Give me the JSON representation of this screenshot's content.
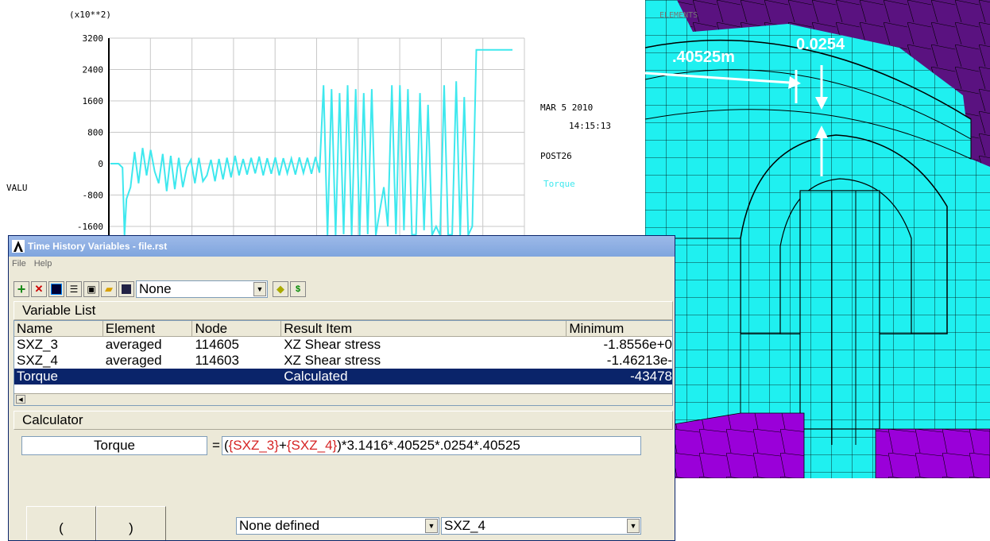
{
  "plot": {
    "exponent_label": "(x10**2)",
    "y_ticks": [
      "3200",
      "2400",
      "1600",
      "800",
      "0",
      "-800",
      "-1600"
    ],
    "ylabel": "VALU",
    "date": "MAR  5 2010",
    "time": "14:15:13",
    "module": "POST26",
    "legend": "Torque",
    "colors": {
      "series": "#3ee8ee",
      "grid": "#c8c8c8",
      "axis": "#000000"
    }
  },
  "chart_data": {
    "type": "line",
    "title": "",
    "xlabel": "",
    "ylabel": "VALU",
    "ylim": [
      -1600,
      3200
    ],
    "y_scale_label": "(x10**2)",
    "grid": true,
    "legend_placement": "right",
    "series": [
      {
        "name": "Torque",
        "color": "#3ee8ee",
        "x": [
          0,
          1,
          2,
          3,
          3.5,
          4,
          5,
          6,
          7,
          8,
          9,
          10,
          11,
          12,
          13,
          14,
          15,
          16,
          17,
          18,
          19,
          20,
          21,
          22,
          23,
          24,
          25,
          26,
          27,
          28,
          29,
          30,
          31,
          32,
          33,
          34,
          35,
          36,
          37,
          38,
          39,
          40,
          41,
          42,
          43,
          44,
          45,
          46,
          47,
          48,
          49,
          50,
          51,
          52,
          53,
          54,
          55,
          56,
          57,
          58,
          59,
          60,
          61,
          62,
          63,
          64,
          65,
          66,
          67,
          68,
          69,
          70,
          71,
          72,
          73,
          74,
          75,
          76,
          77,
          78,
          79,
          80,
          81,
          82,
          83,
          84,
          85,
          86,
          87,
          88,
          89,
          90,
          91,
          92,
          93,
          94,
          95,
          96,
          97,
          98,
          99,
          100
        ],
        "y": [
          0,
          0,
          0,
          -100,
          -2200,
          -900,
          -600,
          300,
          -500,
          400,
          -300,
          350,
          -200,
          -500,
          250,
          -700,
          200,
          -650,
          150,
          -600,
          -100,
          100,
          -500,
          150,
          -450,
          -300,
          100,
          -450,
          120,
          -400,
          150,
          -350,
          200,
          -300,
          120,
          -280,
          150,
          -250,
          180,
          -300,
          140,
          -260,
          160,
          -300,
          140,
          -250,
          130,
          -280,
          160,
          -240,
          150,
          -260,
          170,
          -230,
          2000,
          -2200,
          1900,
          -2000,
          1800,
          -1800,
          2000,
          -2000,
          1900,
          -1900,
          1800,
          -1800,
          1900,
          -2200,
          -1200,
          -600,
          -1600,
          2000,
          -1800,
          2000,
          -1700,
          1900,
          -2200,
          -1800,
          1800,
          -1700,
          1500,
          -2000,
          -1600,
          -2100,
          2000,
          -2200,
          -1800,
          2100,
          -2400,
          1700,
          -2200,
          -1600,
          2900,
          2900,
          2900,
          2900,
          2900,
          2900,
          2900,
          2900,
          2900,
          2900
        ]
      }
    ]
  },
  "model": {
    "label": "ELEMENTS",
    "dim1": ".40525m",
    "dim2": "0.0254",
    "colors": {
      "mesh": "#1ff0f0",
      "purple": "#5a1280",
      "violet": "#9a00d9",
      "line": "#000000"
    }
  },
  "dialog": {
    "title": "Time History Variables - file.rst",
    "menu": [
      "File",
      "Help"
    ],
    "toolbar": {
      "combo_value": "None"
    },
    "variable_list_label": "Variable List",
    "columns": [
      "Name",
      "Element",
      "Node",
      "Result Item",
      "Minimum"
    ],
    "rows": [
      {
        "name": "SXZ_3",
        "element": "averaged",
        "node": "114605",
        "result": "XZ Shear stress",
        "minimum": "-1.8556e+0"
      },
      {
        "name": "SXZ_4",
        "element": "averaged",
        "node": "114603",
        "result": "XZ Shear stress",
        "minimum": "-1.46213e-"
      },
      {
        "name": "Torque",
        "element": "",
        "node": "",
        "result": "Calculated",
        "minimum": "-43478"
      }
    ],
    "calculator_label": "Calculator",
    "calc_name": "Torque",
    "equals": "=",
    "expr_parts": [
      {
        "text": "(",
        "red": false
      },
      {
        "text": "{SXZ_3}",
        "red": true
      },
      {
        "text": "+",
        "red": false
      },
      {
        "text": "{SXZ_4}",
        "red": true
      },
      {
        "text": ")*3.1416*.40525*.0254*.40525",
        "red": false
      }
    ],
    "open_paren": "(",
    "close_paren": ")",
    "combo_left": "None defined",
    "combo_right": "SXZ_4"
  }
}
